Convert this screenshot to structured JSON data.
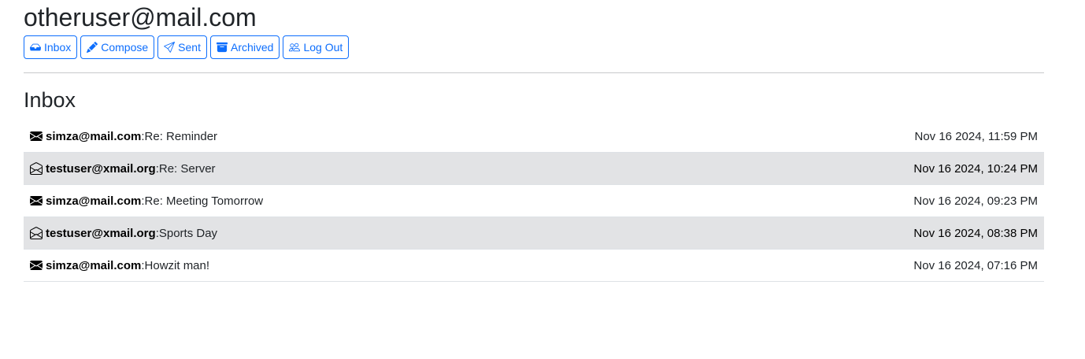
{
  "user": {
    "email": "otheruser@mail.com"
  },
  "nav": {
    "inbox": {
      "label": "Inbox",
      "icon": "inbox-icon"
    },
    "compose": {
      "label": "Compose",
      "icon": "pencil-icon"
    },
    "sent": {
      "label": "Sent",
      "icon": "send-icon"
    },
    "archived": {
      "label": "Archived",
      "icon": "archive-icon"
    },
    "logout": {
      "label": "Log Out",
      "icon": "people-icon"
    }
  },
  "section": {
    "title": "Inbox"
  },
  "emails": [
    {
      "sender": "simza@mail.com",
      "sep": ": ",
      "subject": "Re: Reminder",
      "timestamp": "Nov 16 2024, 11:59 PM",
      "read": false
    },
    {
      "sender": "testuser@xmail.org",
      "sep": ": ",
      "subject": "Re: Server",
      "timestamp": "Nov 16 2024, 10:24 PM",
      "read": true
    },
    {
      "sender": "simza@mail.com",
      "sep": ": ",
      "subject": "Re: Meeting Tomorrow",
      "timestamp": "Nov 16 2024, 09:23 PM",
      "read": false
    },
    {
      "sender": "testuser@xmail.org",
      "sep": ": ",
      "subject": "Sports Day",
      "timestamp": "Nov 16 2024, 08:38 PM",
      "read": true
    },
    {
      "sender": "simza@mail.com",
      "sep": ": ",
      "subject": "Howzit man!",
      "timestamp": "Nov 16 2024, 07:16 PM",
      "read": false
    }
  ],
  "colors": {
    "accent": "#0d6efd",
    "read_row_bg": "#e2e3e5"
  }
}
